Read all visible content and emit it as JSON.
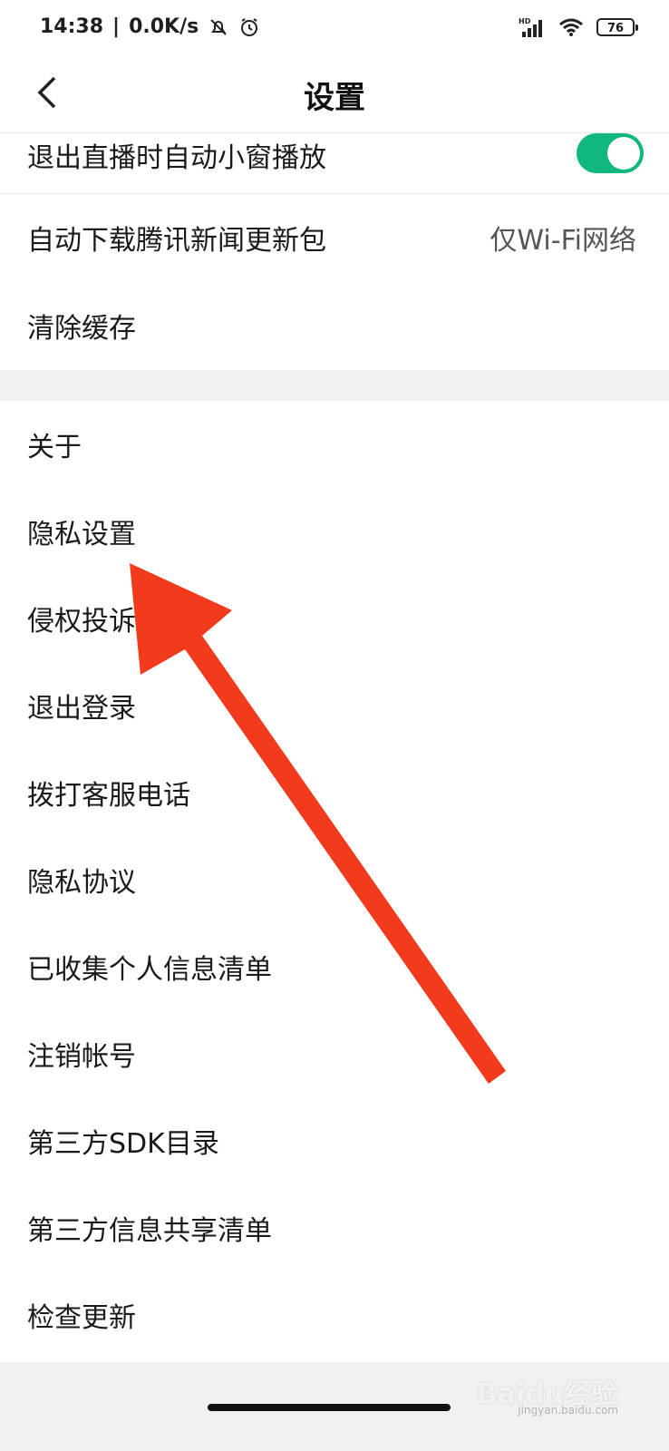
{
  "status_bar": {
    "time": "14:38",
    "network_speed": "0.0K/s",
    "icons": [
      "mute-bell-icon",
      "alarm-icon",
      "hd-signal-icon",
      "wifi-icon"
    ],
    "hd_label": "HD",
    "battery": "76"
  },
  "header": {
    "title": "设置",
    "back_icon": "chevron-left-icon"
  },
  "group1": {
    "partial_row_label": "退出直播时自动小窗播放",
    "toggle_on": true,
    "rows": [
      {
        "label": "自动下载腾讯新闻更新包",
        "value": "仅Wi-Fi网络"
      },
      {
        "label": "清除缓存"
      }
    ]
  },
  "group2": {
    "rows": [
      {
        "label": "关于"
      },
      {
        "label": "隐私设置"
      },
      {
        "label": "侵权投诉"
      },
      {
        "label": "退出登录"
      },
      {
        "label": "拨打客服电话"
      },
      {
        "label": "隐私协议"
      },
      {
        "label": "已收集个人信息清单"
      },
      {
        "label": "注销帐号"
      },
      {
        "label": "第三方SDK目录"
      },
      {
        "label": "第三方信息共享清单"
      },
      {
        "label": "检查更新"
      }
    ]
  },
  "annotation": {
    "arrow_color": "#f23a1d"
  },
  "watermark": {
    "text": "Baidu经验",
    "sub": "jingyan.baidu.com"
  },
  "colors": {
    "toggle_on": "#10b77f",
    "background": "#f1f1f1"
  }
}
